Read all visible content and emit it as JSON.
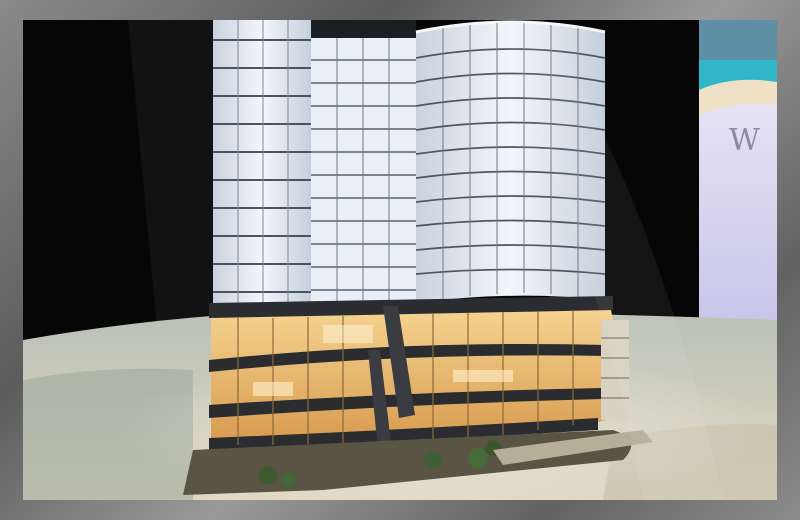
{
  "scene": {
    "colors": {
      "backdrop": "#070707",
      "floor": "#cfcabd",
      "glass": "#dfe7f2",
      "warm_light": "#f3c77a",
      "frame_border": "#7a7a7a",
      "billboard": "#dcd7f0"
    },
    "billboard_text": "W"
  }
}
